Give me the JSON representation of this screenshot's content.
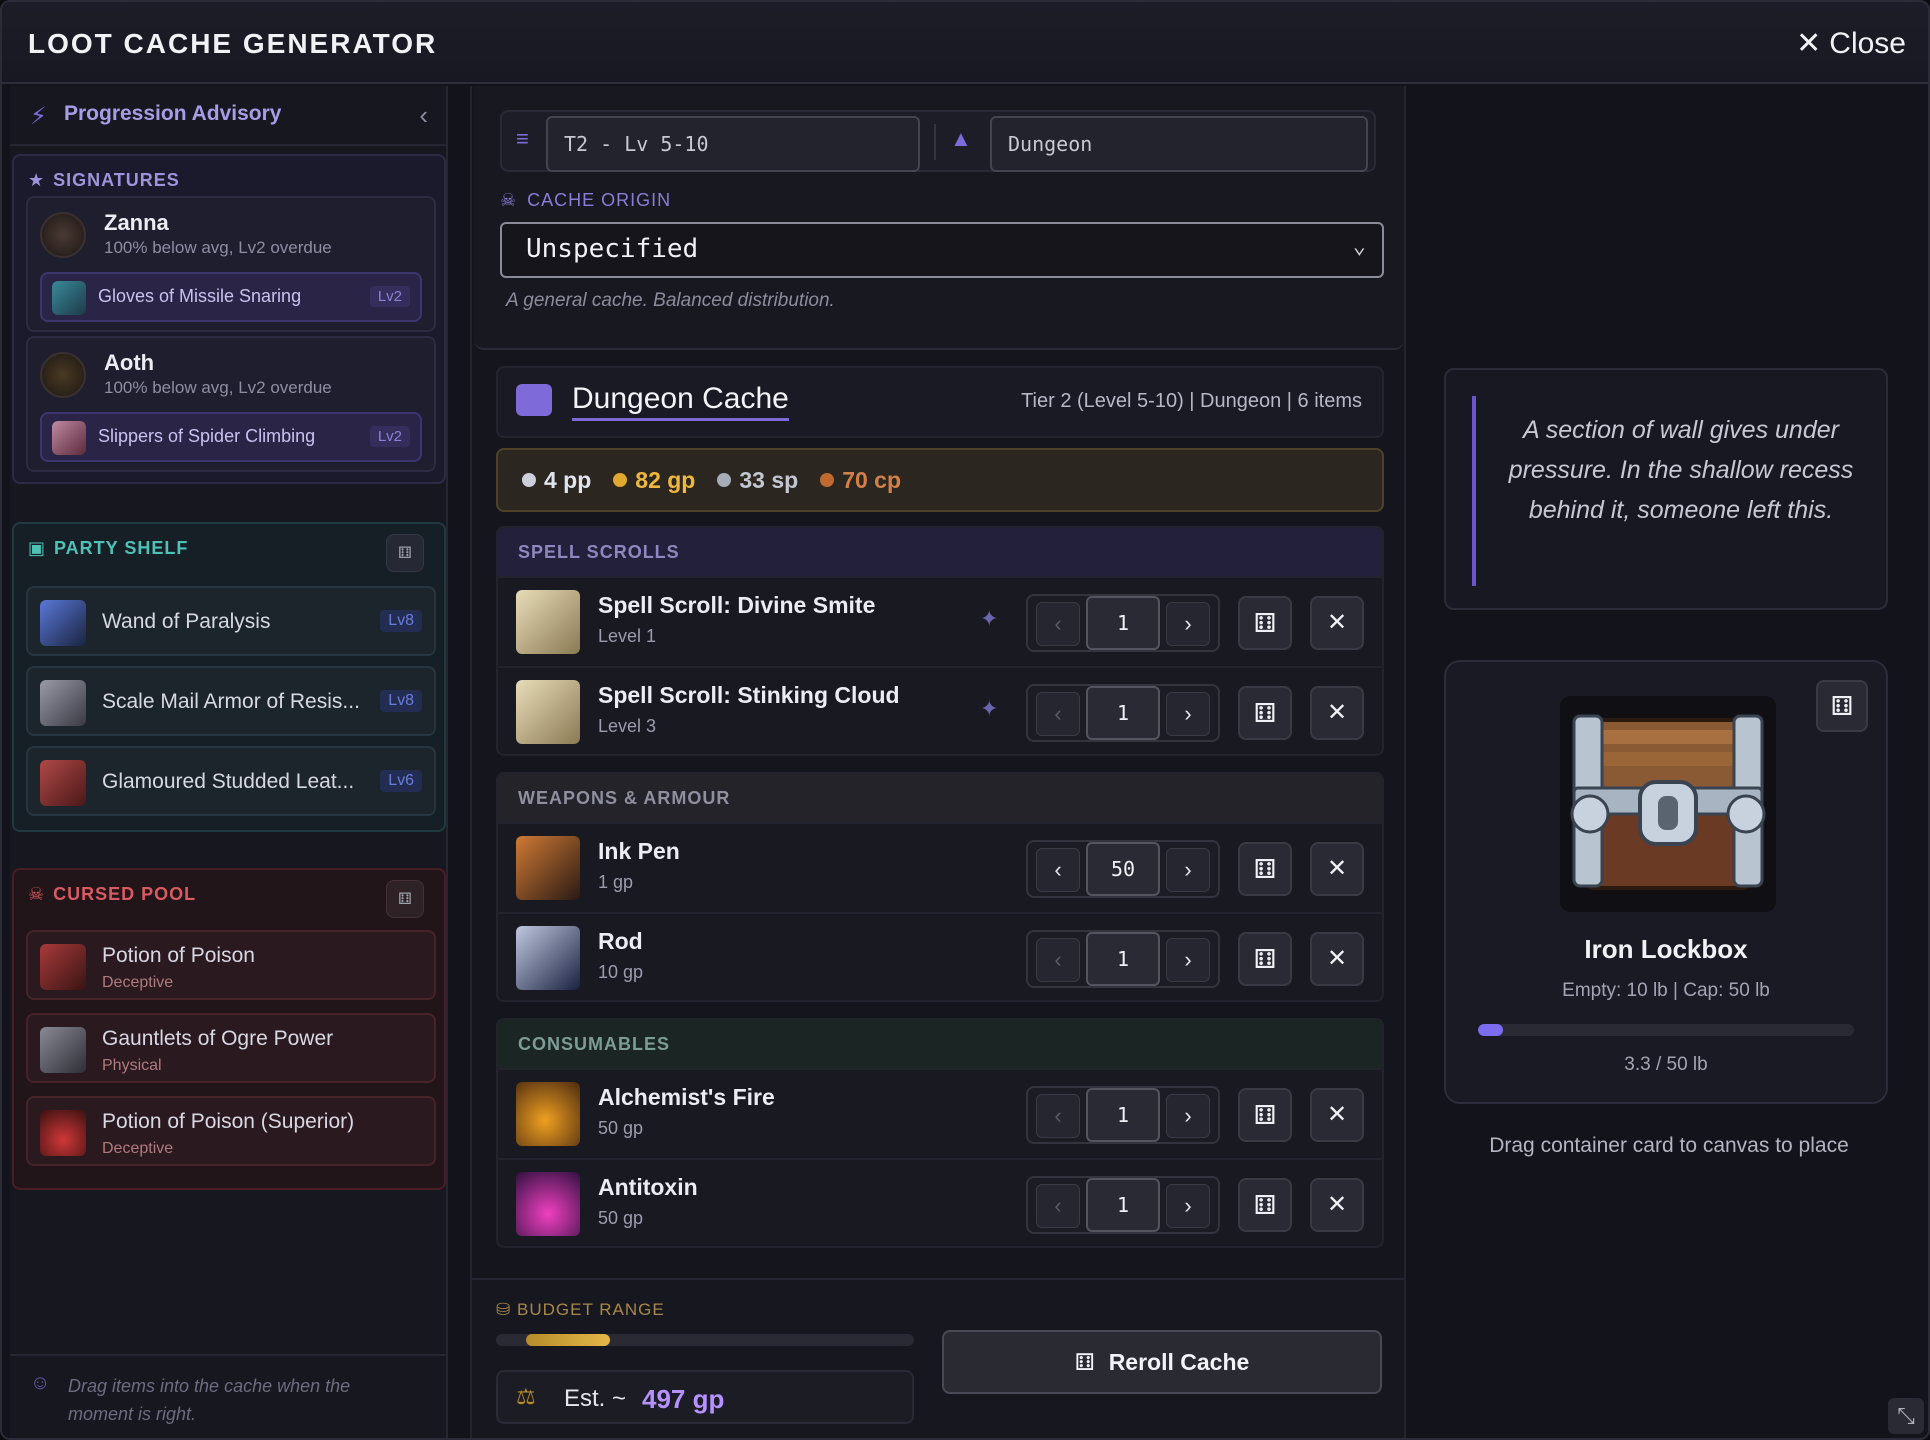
{
  "window": {
    "title": "LOOT CACHE GENERATOR",
    "close_label": "Close"
  },
  "sidebar": {
    "advisory_label": "Progression Advisory",
    "signatures": {
      "heading": "SIGNATURES",
      "characters": [
        {
          "name": "Zanna",
          "status": "100% below avg, Lv2 overdue",
          "item": "Gloves of Missile Snaring",
          "item_level": "Lv2"
        },
        {
          "name": "Aoth",
          "status": "100% below avg, Lv2 overdue",
          "item": "Slippers of Spider Climbing",
          "item_level": "Lv2"
        }
      ]
    },
    "party_shelf": {
      "heading": "PARTY SHELF",
      "items": [
        {
          "name": "Wand of Paralysis",
          "level": "Lv8"
        },
        {
          "name": "Scale Mail Armor of Resis...",
          "level": "Lv8"
        },
        {
          "name": "Glamoured Studded Leat...",
          "level": "Lv6"
        }
      ]
    },
    "cursed_pool": {
      "heading": "CURSED POOL",
      "items": [
        {
          "name": "Potion of Poison",
          "type": "Deceptive"
        },
        {
          "name": "Gauntlets of Ogre Power",
          "type": "Physical"
        },
        {
          "name": "Potion of Poison (Superior)",
          "type": "Deceptive"
        }
      ]
    },
    "drag_hint": "Drag items into the cache when the moment is right."
  },
  "config": {
    "tier_value": "T2 - Lv 5-10",
    "location_value": "Dungeon",
    "origin_label": "CACHE ORIGIN",
    "origin_value": "Unspecified",
    "origin_desc": "A general cache. Balanced distribution."
  },
  "cache": {
    "name": "Dungeon Cache",
    "meta": "Tier 2 (Level 5-10) | Dungeon | 6 items",
    "coins": [
      {
        "label": "4 pp",
        "color": "#c9d0dc",
        "text_color": "#dfe4ee"
      },
      {
        "label": "82 gp",
        "color": "#e0a82e",
        "text_color": "#f0b83a"
      },
      {
        "label": "33 sp",
        "color": "#a6acb8",
        "text_color": "#c2c6d0"
      },
      {
        "label": "70 cp",
        "color": "#c06a30",
        "text_color": "#d2804a"
      }
    ],
    "categories": [
      {
        "heading": "SPELL SCROLLS",
        "items": [
          {
            "name": "Spell Scroll: Divine Smite",
            "sub": "Level 1",
            "qty": "1"
          },
          {
            "name": "Spell Scroll: Stinking Cloud",
            "sub": "Level 3",
            "qty": "1"
          }
        ]
      },
      {
        "heading": "WEAPONS & ARMOUR",
        "items": [
          {
            "name": "Ink Pen",
            "sub": "1 gp",
            "qty": "50"
          },
          {
            "name": "Rod",
            "sub": "10 gp",
            "qty": "1"
          }
        ]
      },
      {
        "heading": "CONSUMABLES",
        "items": [
          {
            "name": "Alchemist's Fire",
            "sub": "50 gp",
            "qty": "1"
          },
          {
            "name": "Antitoxin",
            "sub": "50 gp",
            "qty": "1"
          }
        ]
      }
    ]
  },
  "budget": {
    "label": "BUDGET RANGE",
    "fill_fraction": 0.2,
    "est_label": "Est. ~",
    "est_value": "497 gp",
    "reroll_label": "Reroll Cache"
  },
  "narrative": "A section of wall gives under pressure. In the shallow recess behind it, someone left this.",
  "container": {
    "name": "Iron Lockbox",
    "capacity": "Empty: 10 lb | Cap: 50 lb",
    "weight_text": "3.3 / 50 lb",
    "weight_fraction": 0.066,
    "hint": "Drag container card to canvas to place"
  },
  "icons": [
    "bolt-icon",
    "chevron-left-icon",
    "star-icon",
    "box-icon",
    "skull-icon",
    "dice-icon",
    "close-icon",
    "layers-icon",
    "mountain-icon",
    "chevron-down-icon",
    "wand-icon",
    "scale-icon",
    "coins-icon",
    "resize-icon"
  ]
}
